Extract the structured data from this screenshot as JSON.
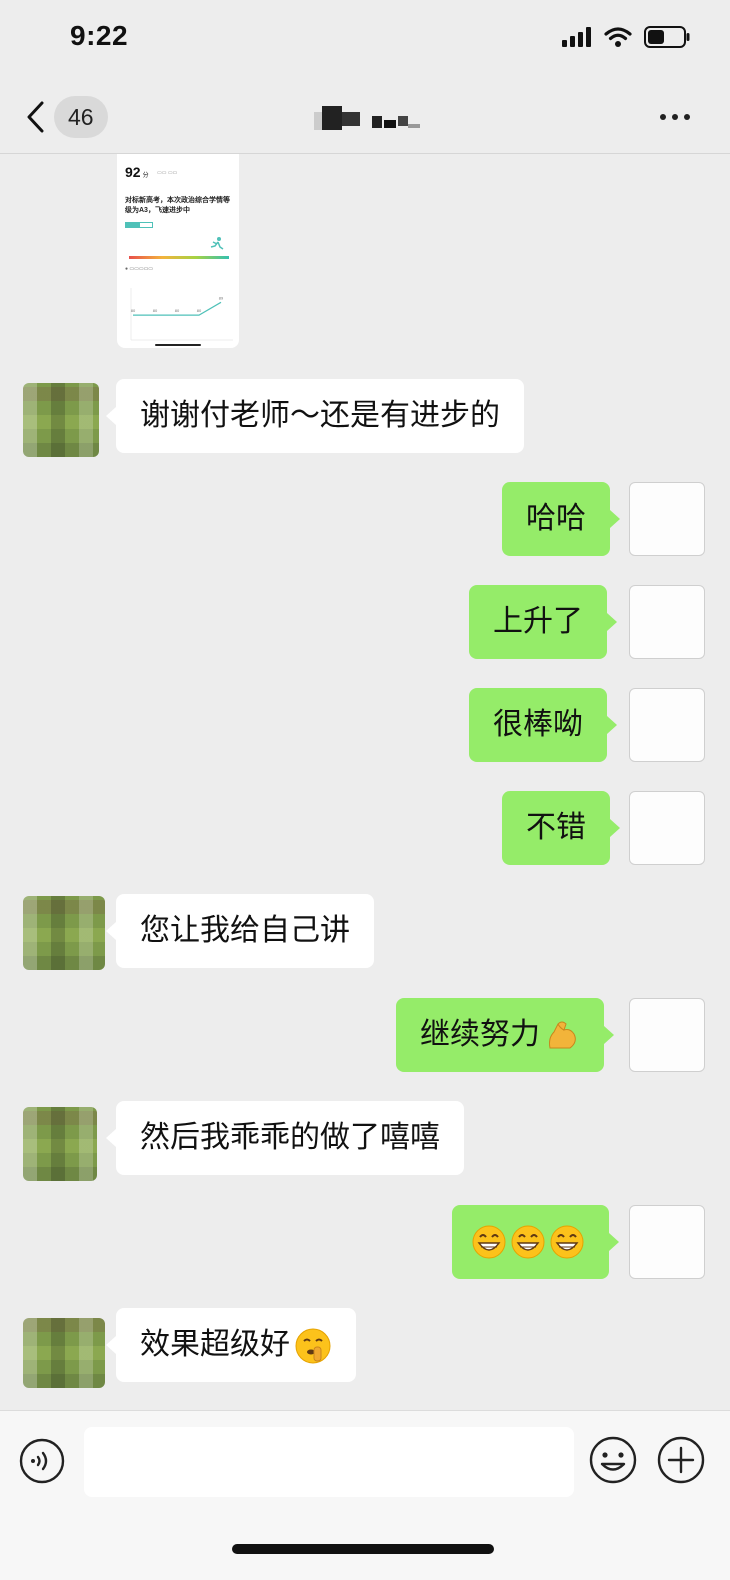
{
  "status_bar": {
    "time": "9:22",
    "icons": [
      "cellular-signal-icon",
      "wifi-icon",
      "battery-icon"
    ]
  },
  "nav": {
    "back_icon": "chevron-left-icon",
    "unread_count": "46",
    "more_icon": "more-dots-icon"
  },
  "shared_image": {
    "score": "92",
    "score_unit": "分",
    "desc": "对标新高考，本次政治综合学情等级为A3，飞速进步中",
    "tabs": [
      "",
      ""
    ],
    "points": [
      80,
      80,
      80,
      80,
      89
    ]
  },
  "messages": [
    {
      "side": "left",
      "text": "谢谢付老师～还是有进步的"
    },
    {
      "side": "right",
      "text": "哈哈"
    },
    {
      "side": "right",
      "text": "上升了"
    },
    {
      "side": "right",
      "text": "很棒呦"
    },
    {
      "side": "right",
      "text": "不错"
    },
    {
      "side": "left",
      "text": "您让我给自己讲"
    },
    {
      "side": "right",
      "text": "继续努力",
      "emoji": "flexed-biceps-icon"
    },
    {
      "side": "left",
      "text": "然后我乖乖的做了嘻嘻"
    },
    {
      "side": "right",
      "text": "",
      "emoji": "grinning-face-x3-icon"
    },
    {
      "side": "left",
      "text": "效果超级好",
      "emoji": "shushing-face-icon"
    }
  ],
  "input_bar": {
    "voice_icon": "voice-icon",
    "placeholder": "",
    "emoji_icon": "emoji-smile-icon",
    "plus_icon": "plus-circle-icon"
  },
  "colors": {
    "background": "#ededed",
    "bubble_self": "#95ec69",
    "bubble_other": "#ffffff",
    "card_accent": "#4fc1b8"
  }
}
